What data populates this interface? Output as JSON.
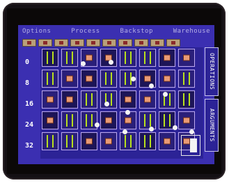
{
  "menu": {
    "items": [
      "Options",
      "Process",
      "Backstop",
      "Warehouse"
    ]
  },
  "rows": {
    "labels": [
      "0",
      "8",
      "16",
      "24",
      "32"
    ]
  },
  "sidebar": {
    "operations_label": "OPERATIONS",
    "arguments_label": "ARGUMENTS"
  },
  "colors": {
    "screen_bg": "#3b2fb1",
    "board_bg": "#2c2396",
    "accent_green": "#b8e01c",
    "gem": "#e99a75",
    "node": "#f4f4f4"
  }
}
